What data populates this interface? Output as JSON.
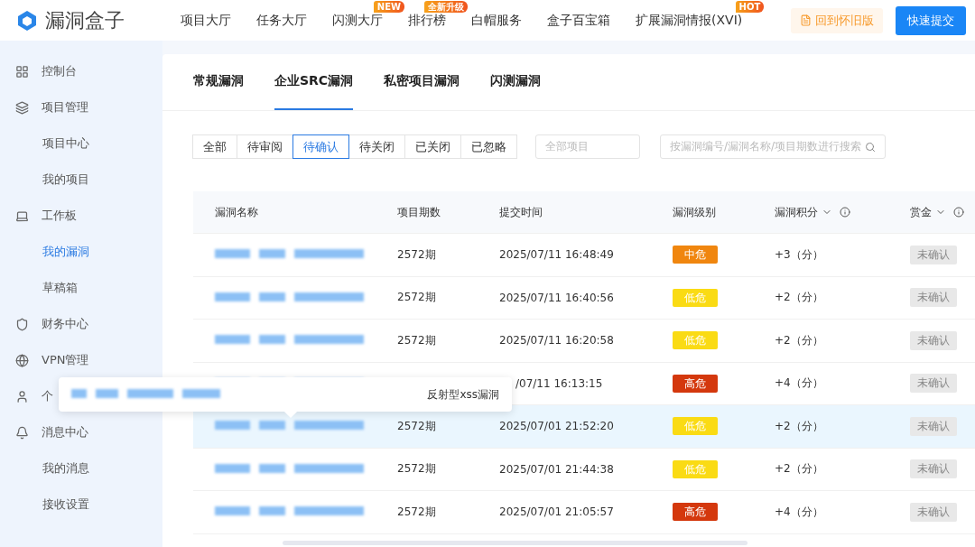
{
  "header": {
    "logo": "漏洞盒子",
    "nav": [
      {
        "label": "项目大厅"
      },
      {
        "label": "任务大厅"
      },
      {
        "label": "闪测大厅",
        "badge": "NEW"
      },
      {
        "label": "排行榜",
        "badge": "全新升级"
      },
      {
        "label": "白帽服务"
      },
      {
        "label": "盒子百宝箱"
      },
      {
        "label": "扩展漏洞情报(XVI)",
        "badge": "HOT"
      }
    ],
    "legacy_link": "回到怀旧版",
    "submit_button": "快速提交"
  },
  "sidebar": {
    "items": [
      {
        "label": "控制台",
        "selected": false
      },
      {
        "label": "项目管理",
        "selected": false,
        "children": [
          {
            "label": "项目中心",
            "selected": false
          },
          {
            "label": "我的项目",
            "selected": false
          }
        ]
      },
      {
        "label": "工作板",
        "selected": false,
        "children": [
          {
            "label": "我的漏洞",
            "selected": true
          },
          {
            "label": "草稿箱",
            "selected": false
          }
        ]
      },
      {
        "label": "财务中心",
        "selected": false
      },
      {
        "label": "VPN管理",
        "selected": false
      },
      {
        "label": "个",
        "selected": false
      },
      {
        "label": "消息中心",
        "selected": false,
        "children": [
          {
            "label": "我的消息",
            "selected": false
          },
          {
            "label": "接收设置",
            "selected": false
          }
        ]
      }
    ]
  },
  "tabs": [
    {
      "label": "常规漏洞",
      "selected": false
    },
    {
      "label": "企业SRC漏洞",
      "selected": true
    },
    {
      "label": "私密项目漏洞",
      "selected": false
    },
    {
      "label": "闪测漏洞",
      "selected": false
    }
  ],
  "status_filters": [
    {
      "label": "全部",
      "selected": false
    },
    {
      "label": "待审阅",
      "selected": false
    },
    {
      "label": "待确认",
      "selected": true
    },
    {
      "label": "待关闭",
      "selected": false
    },
    {
      "label": "已关闭",
      "selected": false
    },
    {
      "label": "已忽略",
      "selected": false
    }
  ],
  "project_select": {
    "placeholder": "全部项目"
  },
  "search": {
    "placeholder": "按漏洞编号/漏洞名称/项目期数进行搜索"
  },
  "table": {
    "columns": [
      {
        "label": "漏洞名称",
        "kind": "plain"
      },
      {
        "label": "项目期数",
        "kind": "plain"
      },
      {
        "label": "提交时间",
        "kind": "plain"
      },
      {
        "label": "漏洞级别",
        "kind": "plain"
      },
      {
        "label": "漏洞积分",
        "kind": "sortable"
      },
      {
        "label": "赏金",
        "kind": "sortable"
      }
    ],
    "rows": [
      {
        "period": "2572期",
        "time": "2025/07/11 16:48:49",
        "level": "中危",
        "color": "#f0860f",
        "score": "+3（分）",
        "reward": "未确认",
        "highlighted": false
      },
      {
        "period": "2572期",
        "time": "2025/07/11 16:40:56",
        "level": "低危",
        "color": "#fadb14",
        "score": "+2（分）",
        "reward": "未确认",
        "highlighted": false
      },
      {
        "period": "2572期",
        "time": "2025/07/11 16:20:58",
        "level": "低危",
        "color": "#fadb14",
        "score": "+2（分）",
        "reward": "未确认",
        "highlighted": false
      },
      {
        "time": "/07/11 16:13:15",
        "level": "高危",
        "color": "#d4380d",
        "score": "+4（分）",
        "reward": "未确认",
        "highlighted": false
      },
      {
        "period": "2572期",
        "time": "2025/07/01 21:52:20",
        "level": "低危",
        "color": "#fadb14",
        "score": "+2（分）",
        "reward": "未确认",
        "highlighted": true
      },
      {
        "period": "2572期",
        "time": "2025/07/01 21:44:38",
        "level": "低危",
        "color": "#fadb14",
        "score": "+2（分）",
        "reward": "未确认",
        "highlighted": false
      },
      {
        "period": "2572期",
        "time": "2025/07/01 21:05:57",
        "level": "高危",
        "color": "#d4380d",
        "score": "+4（分）",
        "reward": "未确认",
        "highlighted": false
      }
    ]
  },
  "tooltip": {
    "text": "反射型xss漏洞"
  }
}
